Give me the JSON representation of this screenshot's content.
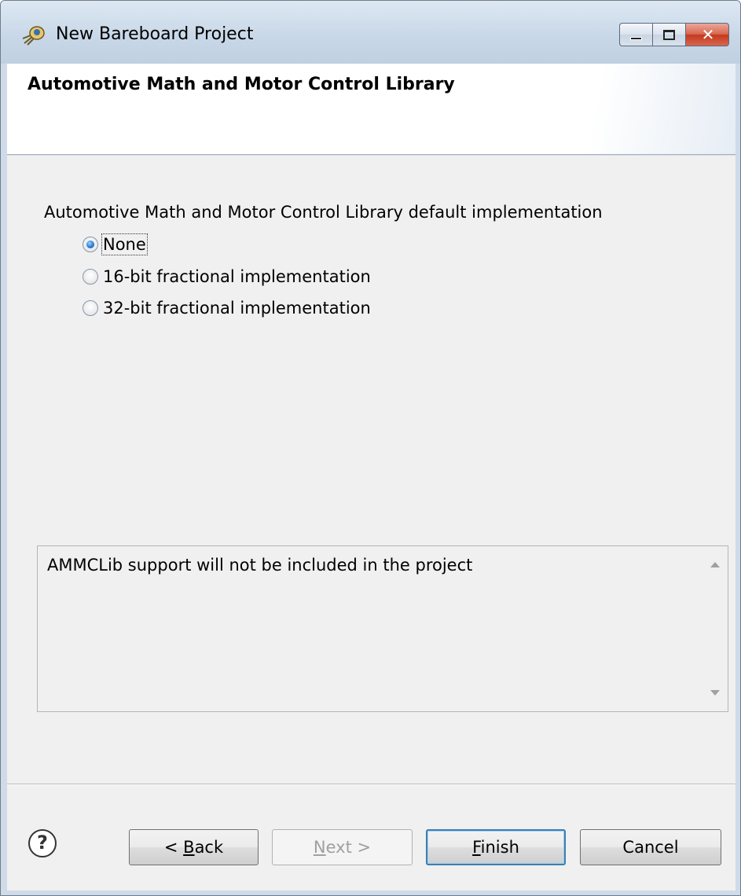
{
  "window": {
    "title": "New Bareboard Project",
    "icon": "eclipse-bug-icon",
    "controls": {
      "minimize": "minimize-icon",
      "maximize": "maximize-icon",
      "close_glyph": "✕"
    }
  },
  "banner": {
    "title": "Automotive Math and Motor Control Library"
  },
  "options": {
    "group_label": "Automotive Math and Motor Control Library default implementation",
    "items": [
      {
        "label": "None",
        "checked": true
      },
      {
        "label": "16-bit fractional implementation",
        "checked": false
      },
      {
        "label": "32-bit fractional implementation",
        "checked": false
      }
    ]
  },
  "description": {
    "text": "AMMCLib support will not be included in the project"
  },
  "buttons": {
    "help_glyph": "?",
    "back": {
      "prefix": "< ",
      "mnemonic": "B",
      "rest": "ack"
    },
    "next": {
      "mnemonic": "N",
      "rest": "ext >"
    },
    "finish": {
      "mnemonic": "F",
      "rest": "inish"
    },
    "cancel": "Cancel"
  },
  "colors": {
    "title_bar": "#c9d8e8",
    "close_button": "#c33a1f",
    "content_background": "#f0f0f0",
    "default_button_border": "#3c7fb1"
  }
}
